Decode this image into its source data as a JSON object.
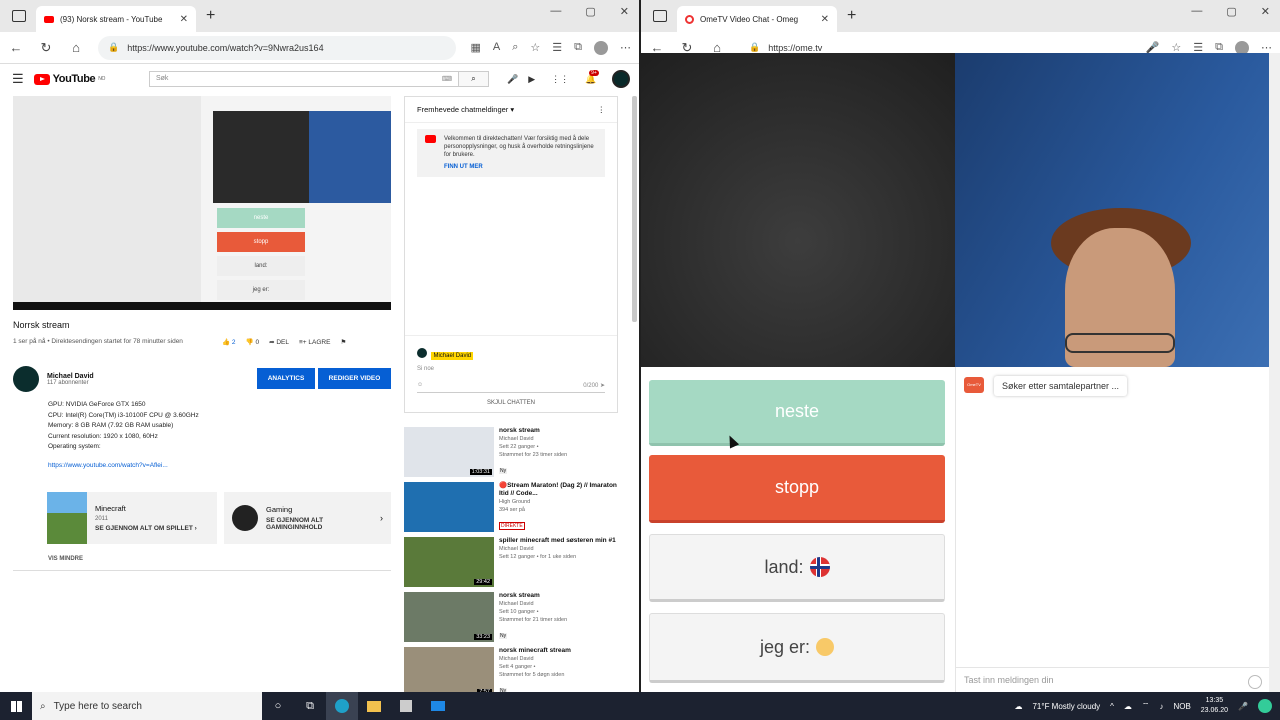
{
  "left_window": {
    "tab_title": "(93) Norsk stream - YouTube",
    "url": "https://www.youtube.com/watch?v=9Nwra2us164"
  },
  "youtube": {
    "logo_text": "YouTube",
    "logo_sup": "NO",
    "search_placeholder": "Søk",
    "notif_count": "9+",
    "video_title": "Norrsk stream",
    "video_meta": "1 ser på nå • Direktesendingen startet for 78 minutter siden",
    "likes": "2",
    "dislikes": "0",
    "share": "DEL",
    "save": "LAGRE",
    "channel_name": "Michael David",
    "subscribers": "117 abonnenter",
    "analytics_btn": "ANALYTICS",
    "edit_btn": "REDIGER VIDEO",
    "description": [
      "GPU: NVIDIA GeForce GTX 1650",
      "CPU: Intel(R) Core(TM) i3-10100F CPU @ 3.60GHz",
      "Memory: 8 GB RAM (7.92 GB RAM usable)",
      "Current resolution: 1920 x 1080, 60Hz",
      "Operating system:"
    ],
    "desc_link": "https://www.youtube.com/watch?v=Aflei...",
    "card1": {
      "title": "Minecraft",
      "year": "2011",
      "btn": "SE GJENNOM ALT OM SPILLET"
    },
    "card2": {
      "title": "Gaming",
      "btn1": "SE GJENNOM ALT",
      "btn2": "GAMINGINNHOLD"
    },
    "vis_mindre": "VIS MINDRE",
    "player_labels": {
      "neste": "neste",
      "stopp": "stopp",
      "land": "land:",
      "jeg": "jeg er:"
    }
  },
  "chat": {
    "header": "Fremhevede chatmeldinger",
    "welcome": "Velkommen til direktechatten! Vær forsiktig med å dele personopplysninger, og husk å overholde retningslinjene for brukere.",
    "learn_more": "FINN UT MER",
    "user": "Michael David",
    "say": "Si noe",
    "counter": "0/200",
    "hide": "SKJUL CHATTEN"
  },
  "recommendations": [
    {
      "title": "norsk stream",
      "channel": "Michael David",
      "l1": "Sett 22 ganger •",
      "l2": "Strømmet for 23 timer siden",
      "badge": "Ny",
      "dur": "1:03:31",
      "color": "#e0e4ea"
    },
    {
      "title": "🔴Stream Maraton! (Dag 2) // Imaraton Itid // Code...",
      "channel": "High Ground",
      "l1": "394 ser på",
      "l2": "",
      "badge": "DIREKTE",
      "dur": "",
      "color": "#1f6fb0"
    },
    {
      "title": "spiller minecraft med søsteren min #1",
      "channel": "Michael David",
      "l1": "Sett 12 ganger • for 1 uke siden",
      "l2": "",
      "badge": "",
      "dur": "29:42",
      "color": "#5a7a3a"
    },
    {
      "title": "norsk stream",
      "channel": "Michael David",
      "l1": "Sett 10 ganger •",
      "l2": "Strømmet for 21 timer siden",
      "badge": "Ny",
      "dur": "33:23",
      "color": "#6c7a66"
    },
    {
      "title": "norsk minecraft stream",
      "channel": "Michael David",
      "l1": "Sett 4 ganger •",
      "l2": "Strømmet for 5 døgn siden",
      "badge": "Ny",
      "dur": "7:57",
      "color": "#9a8f7a"
    }
  ],
  "right_window": {
    "tab_title": "OmeTV Video Chat - Omeg",
    "url": "https://ome.tv"
  },
  "ometv": {
    "neste": "neste",
    "stopp": "stopp",
    "land": "land:",
    "jeg_er": "jeg er:",
    "logo": "OmeTV",
    "searching": "Søker etter samtalepartner ...",
    "input_placeholder": "Tast inn meldingen din"
  },
  "taskbar": {
    "search": "Type here to search",
    "weather": "71°F  Mostly cloudy",
    "lang": "NOB",
    "time": "13:35",
    "date": "23.06.20"
  }
}
